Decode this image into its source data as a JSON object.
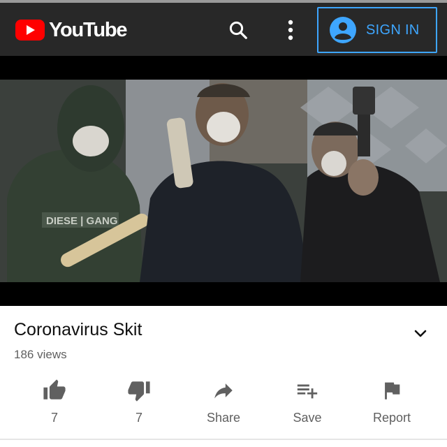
{
  "header": {
    "logo_text": "YouTube",
    "signin_label": "SIGN IN"
  },
  "video": {
    "title": "Coronavirus Skit",
    "views": "186 views"
  },
  "actions": {
    "like_count": "7",
    "dislike_count": "7",
    "share_label": "Share",
    "save_label": "Save",
    "report_label": "Report"
  },
  "icons": {
    "logo": "youtube-logo-icon",
    "search": "search-icon",
    "more": "more-vert-icon",
    "account": "account-circle-icon",
    "expand": "chevron-down-icon",
    "like": "thumb-up-icon",
    "dislike": "thumb-down-icon",
    "share": "share-arrow-icon",
    "save": "playlist-add-icon",
    "report": "flag-icon"
  },
  "colors": {
    "header_bg": "#282828",
    "brand_red": "#ff0000",
    "signin_blue": "#3ea6ff",
    "icon_gray": "#606060"
  }
}
